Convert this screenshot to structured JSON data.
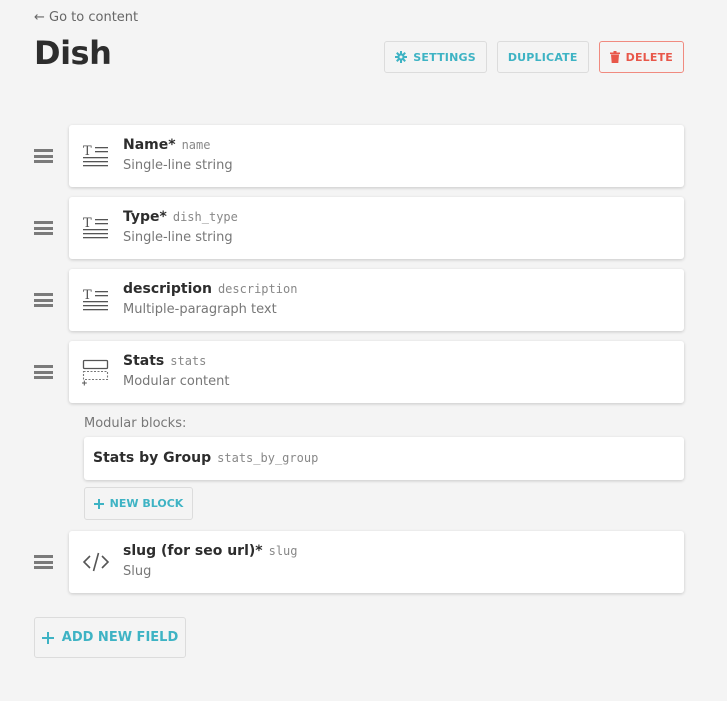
{
  "nav": {
    "back_label": "← Go to content"
  },
  "page": {
    "title": "Dish"
  },
  "actions": {
    "settings_label": "SETTINGS",
    "duplicate_label": "DUPLICATE",
    "delete_label": "DELETE"
  },
  "fields": [
    {
      "title": "Name*",
      "api_key": "name",
      "type": "Single-line string",
      "icon": "text-field-icon"
    },
    {
      "title": "Type*",
      "api_key": "dish_type",
      "type": "Single-line string",
      "icon": "text-field-icon"
    },
    {
      "title": "description",
      "api_key": "description",
      "type": "Multiple-paragraph text",
      "icon": "text-field-icon"
    },
    {
      "title": "Stats",
      "api_key": "stats",
      "type": "Modular content",
      "icon": "modular-content-icon"
    },
    {
      "title": "slug (for seo url)*",
      "api_key": "slug",
      "type": "Slug",
      "icon": "code-icon"
    }
  ],
  "modular": {
    "label": "Modular blocks:",
    "blocks": [
      {
        "title": "Stats by Group",
        "api_key": "stats_by_group"
      }
    ],
    "new_block_label": "NEW BLOCK"
  },
  "add_field_label": "ADD NEW FIELD",
  "colors": {
    "accent": "#3eb3c4",
    "danger": "#e8574a",
    "background": "#f4f4f4"
  }
}
